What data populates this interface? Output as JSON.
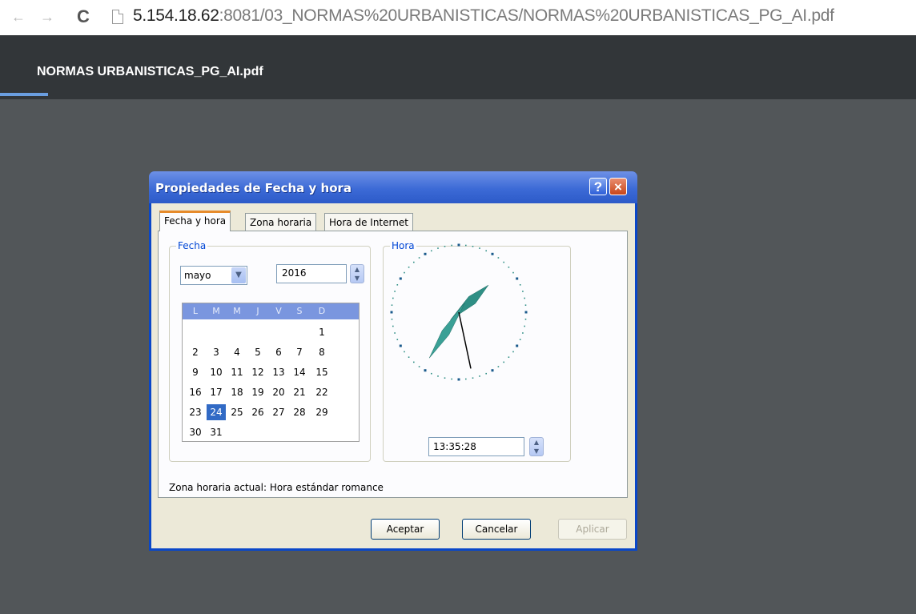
{
  "browser": {
    "back_icon": "←",
    "forward_icon": "→",
    "reload_icon": "C",
    "url_host": "5.154.18.62",
    "url_rest": ":8081/03_NORMAS%20URBANISTICAS/NORMAS%20URBANISTICAS_PG_AI.pdf"
  },
  "viewer": {
    "doc_title": "NORMAS URBANISTICAS_PG_AI.pdf"
  },
  "dialog": {
    "title": "Propiedades de Fecha y hora",
    "help_label": "?",
    "close_label": "×",
    "tabs": [
      {
        "label": "Fecha y hora",
        "active": true
      },
      {
        "label": "Zona horaria",
        "active": false
      },
      {
        "label": "Hora de Internet",
        "active": false
      }
    ],
    "date": {
      "group_label": "Fecha",
      "month": "mayo",
      "year": "2016",
      "weekdays": [
        "L",
        "M",
        "M",
        "J",
        "V",
        "S",
        "D"
      ],
      "weeks": [
        [
          "",
          "",
          "",
          "",
          "",
          "",
          "1"
        ],
        [
          "2",
          "3",
          "4",
          "5",
          "6",
          "7",
          "8"
        ],
        [
          "9",
          "10",
          "11",
          "12",
          "13",
          "14",
          "15"
        ],
        [
          "16",
          "17",
          "18",
          "19",
          "20",
          "21",
          "22"
        ],
        [
          "23",
          "24",
          "25",
          "26",
          "27",
          "28",
          "29"
        ],
        [
          "30",
          "31",
          "",
          "",
          "",
          "",
          ""
        ]
      ],
      "selected_day": "24"
    },
    "time": {
      "group_label": "Hora",
      "value": "13:35:28"
    },
    "timezone_text": "Zona horaria actual:  Hora estándar romance",
    "buttons": {
      "ok": "Aceptar",
      "cancel": "Cancelar",
      "apply": "Aplicar"
    }
  },
  "colors": {
    "titlebar": "#3c6ad6",
    "dialog_face": "#ece9d8",
    "clock_hand": "#2f8f85",
    "viewer_header": "#323639",
    "viewer_bg": "#525659"
  },
  "icons": {
    "dropdown": "chevron-down-icon",
    "spinner": "spin-up-down-icon",
    "page": "page-icon"
  }
}
